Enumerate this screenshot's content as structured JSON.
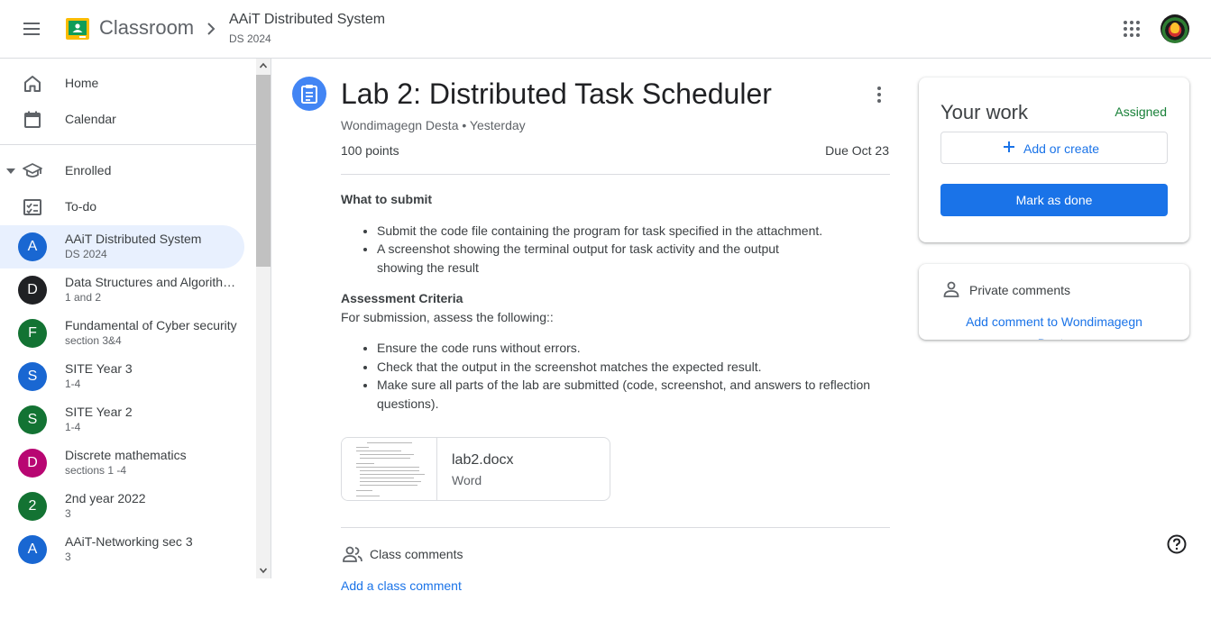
{
  "header": {
    "app_name": "Classroom",
    "course_title": "AAiT Distributed System",
    "course_subtitle": "DS 2024"
  },
  "sidebar": {
    "nav": [
      {
        "label": "Home",
        "icon": "home-icon"
      },
      {
        "label": "Calendar",
        "icon": "calendar-icon"
      }
    ],
    "enrolled_label": "Enrolled",
    "todo_label": "To-do",
    "classes": [
      {
        "initial": "A",
        "name": "AAiT Distributed System",
        "sub": "DS 2024",
        "color": "#1967d2"
      },
      {
        "initial": "D",
        "name": "Data Structures and Algorithms",
        "sub": "1 and 2",
        "color": "#202124"
      },
      {
        "initial": "F",
        "name": "Fundamental of Cyber security",
        "sub": "section 3&4",
        "color": "#137333"
      },
      {
        "initial": "S",
        "name": "SITE Year 3",
        "sub": "1-4",
        "color": "#1967d2"
      },
      {
        "initial": "S",
        "name": "SITE Year 2",
        "sub": "1-4",
        "color": "#137333"
      },
      {
        "initial": "D",
        "name": "Discrete mathematics",
        "sub": "sections 1 -4",
        "color": "#b80672"
      },
      {
        "initial": "2",
        "name": "2nd year 2022",
        "sub": "3",
        "color": "#137333"
      },
      {
        "initial": "A",
        "name": "AAiT-Networking sec 3",
        "sub": "3",
        "color": "#1967d2"
      }
    ]
  },
  "assignment": {
    "title": "Lab 2: Distributed Task Scheduler",
    "meta": "Wondimagegn Desta • Yesterday",
    "points": "100 points",
    "due": "Due Oct 23",
    "what_heading": "What to submit",
    "what_items": [
      "Submit the code file containing the program for task   specified in the attachment.",
      "A screenshot showing the terminal output for task activity and the output showing the result"
    ],
    "criteria_heading": "Assessment Criteria",
    "criteria_intro": "For submission, assess the following::",
    "criteria_items": [
      "Ensure the code runs without errors.",
      "Check that the output in the screenshot matches the expected result.",
      "Make sure all parts of the lab are submitted (code, screenshot, and answers to reflection questions)."
    ],
    "attachment": {
      "name": "lab2.docx",
      "type": "Word"
    }
  },
  "class_comments": {
    "label": "Class comments",
    "add": "Add a class comment"
  },
  "your_work": {
    "title": "Your work",
    "status": "Assigned",
    "add_label": "Add or create",
    "done_label": "Mark as done"
  },
  "private_comments": {
    "label": "Private comments",
    "add": "Add comment to Wondimagegn Desta"
  },
  "colors": {
    "accent": "#1a73e8",
    "assigned": "#188038",
    "active_bg": "#e8f0fe"
  }
}
